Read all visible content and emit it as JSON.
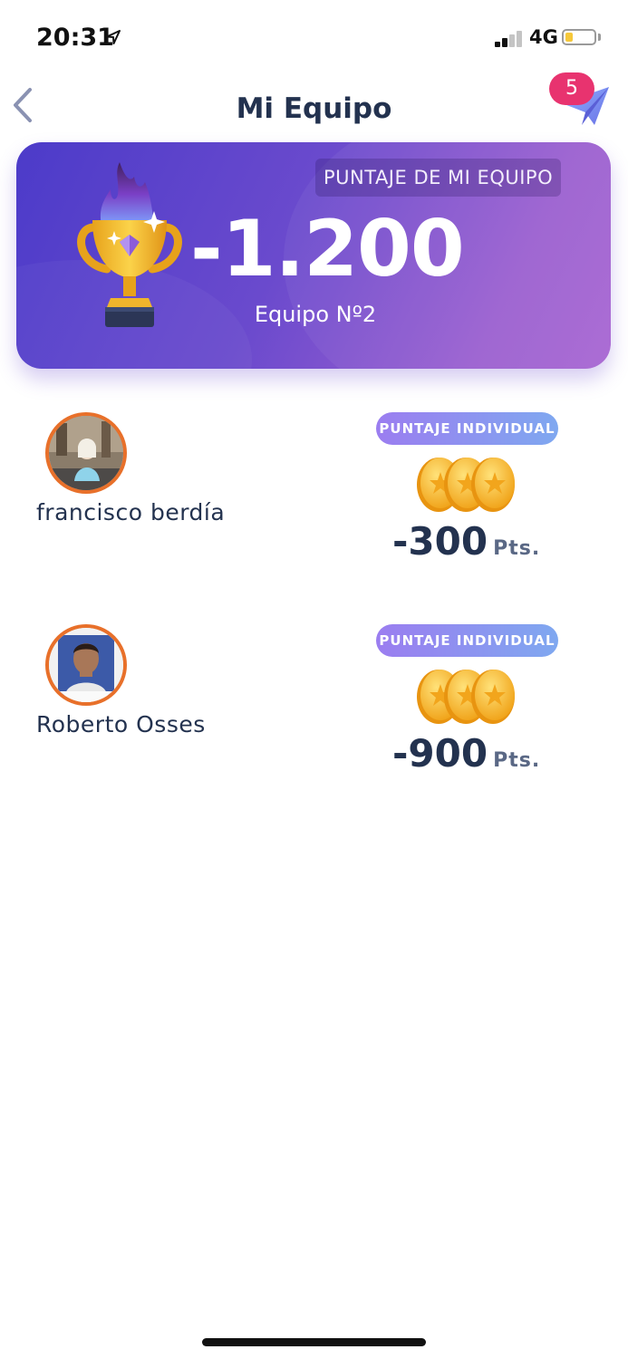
{
  "status_bar": {
    "time": "20:31",
    "network": "4G",
    "battery_level": 0.25,
    "signal_bars": 2
  },
  "nav": {
    "title": "Mi Equipo",
    "notification_count": "5",
    "back_icon": "chevron-left-icon",
    "send_icon": "paper-plane-icon"
  },
  "team_card": {
    "label": "PUNTAJE DE MI EQUIPO",
    "score": "-1.200",
    "team_name": "Equipo Nº2",
    "icon": "trophy-icon"
  },
  "members": [
    {
      "name": "francisco berdía",
      "score_label": "PUNTAJE INDIVIDUAL",
      "score": "-300",
      "unit": "Pts."
    },
    {
      "name": "Roberto Osses",
      "score_label": "PUNTAJE INDIVIDUAL",
      "score": "-900",
      "unit": "Pts."
    }
  ],
  "colors": {
    "accent_orange": "#e8702a",
    "badge_pink": "#e8336f",
    "title_navy": "#23324f",
    "card_purple": "#6a4acd"
  }
}
